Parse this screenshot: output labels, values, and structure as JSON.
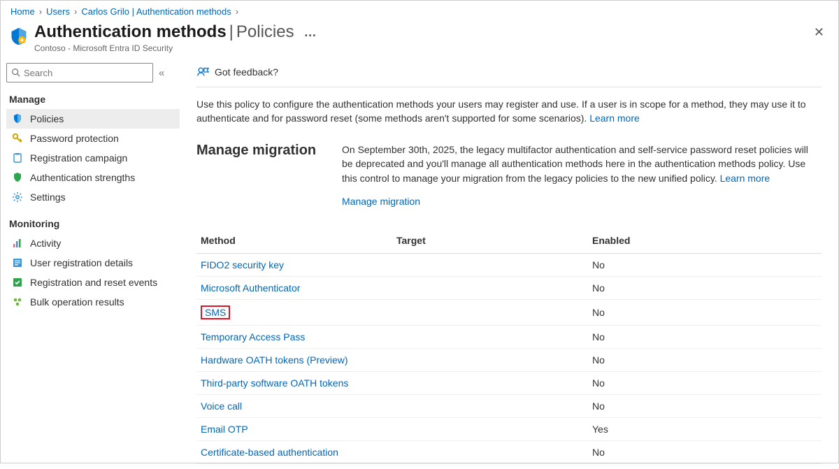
{
  "breadcrumb": [
    {
      "label": "Home"
    },
    {
      "label": "Users"
    },
    {
      "label": "Carlos Grilo | Authentication methods"
    }
  ],
  "header": {
    "title_main": "Authentication methods",
    "title_sep": " | ",
    "title_sub": "Policies",
    "subtitle": "Contoso - Microsoft Entra ID Security"
  },
  "search": {
    "placeholder": "Search"
  },
  "nav": {
    "manage_label": "Manage",
    "manage_items": [
      {
        "label": "Policies",
        "active": true
      },
      {
        "label": "Password protection"
      },
      {
        "label": "Registration campaign"
      },
      {
        "label": "Authentication strengths"
      },
      {
        "label": "Settings"
      }
    ],
    "monitoring_label": "Monitoring",
    "monitoring_items": [
      {
        "label": "Activity"
      },
      {
        "label": "User registration details"
      },
      {
        "label": "Registration and reset events"
      },
      {
        "label": "Bulk operation results"
      }
    ]
  },
  "feedback_label": "Got feedback?",
  "intro_text": "Use this policy to configure the authentication methods your users may register and use. If a user is in scope for a method, they may use it to authenticate and for password reset (some methods aren't supported for some scenarios). ",
  "learn_more": "Learn more",
  "migration": {
    "heading": "Manage migration",
    "body": "On September 30th, 2025, the legacy multifactor authentication and self-service password reset policies will be deprecated and you'll manage all authentication methods here in the authentication methods policy. Use this control to manage your migration from the legacy policies to the new unified policy. ",
    "link": "Manage migration"
  },
  "table": {
    "headers": {
      "method": "Method",
      "target": "Target",
      "enabled": "Enabled"
    },
    "rows": [
      {
        "method": "FIDO2 security key",
        "target": "",
        "enabled": "No",
        "highlight": false
      },
      {
        "method": "Microsoft Authenticator",
        "target": "",
        "enabled": "No",
        "highlight": false
      },
      {
        "method": "SMS",
        "target": "",
        "enabled": "No",
        "highlight": true
      },
      {
        "method": "Temporary Access Pass",
        "target": "",
        "enabled": "No",
        "highlight": false
      },
      {
        "method": "Hardware OATH tokens (Preview)",
        "target": "",
        "enabled": "No",
        "highlight": false
      },
      {
        "method": "Third-party software OATH tokens",
        "target": "",
        "enabled": "No",
        "highlight": false
      },
      {
        "method": "Voice call",
        "target": "",
        "enabled": "No",
        "highlight": false
      },
      {
        "method": "Email OTP",
        "target": "",
        "enabled": "Yes",
        "highlight": false
      },
      {
        "method": "Certificate-based authentication",
        "target": "",
        "enabled": "No",
        "highlight": false
      }
    ]
  }
}
